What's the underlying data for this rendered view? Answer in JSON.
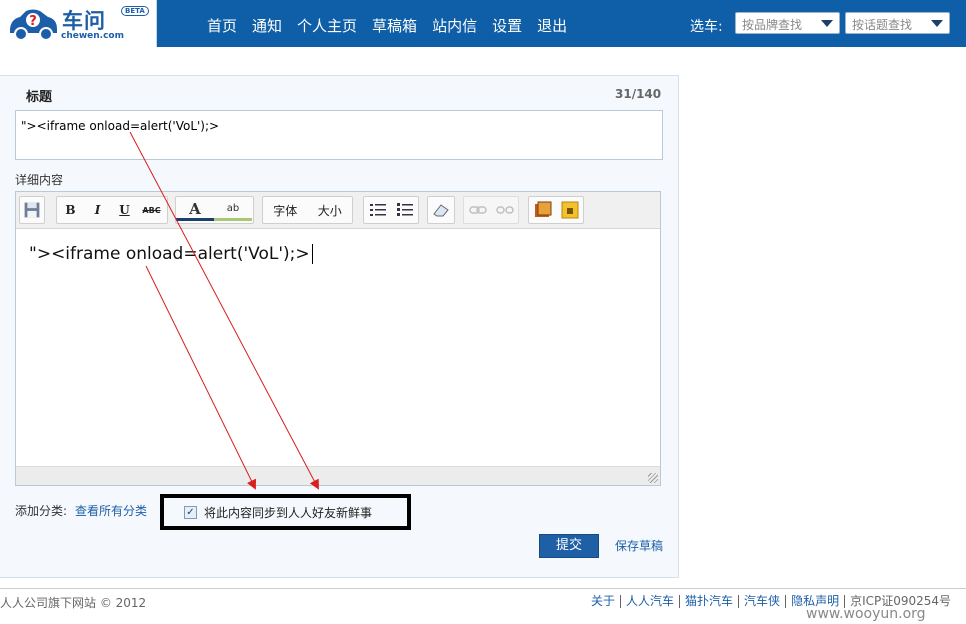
{
  "logo": {
    "brand": "车问",
    "badge": "BETA",
    "domain": "chewen.com"
  },
  "nav": [
    "首页",
    "通知",
    "个人主页",
    "草稿箱",
    "站内信",
    "设置",
    "退出"
  ],
  "car_picker": {
    "label": "选车:",
    "brand_placeholder": "按品牌查找",
    "topic_placeholder": "按话题查找"
  },
  "form": {
    "title_label": "标题",
    "counter": "31/140",
    "title_value": "\"><iframe onload=alert('VoL');>",
    "detail_label": "详细内容",
    "content_value": "\"><iframe onload=alert('VoL');>",
    "category_label": "添加分类:",
    "category_link": "查看所有分类",
    "sync_label": "将此内容同步到人人好友新鲜事",
    "sync_checked": true,
    "submit_label": "提交",
    "draft_label": "保存草稿"
  },
  "toolbar": {
    "bold": "B",
    "italic": "I",
    "underline": "U",
    "strike": "ABC",
    "font_color": "A",
    "highlight": "ab",
    "font_label": "字体",
    "size_label": "大小"
  },
  "footer": {
    "copyright": "人人公司旗下网站 © 2012",
    "links": [
      "关于",
      "人人汽车",
      "猫扑汽车",
      "汽车侠",
      "隐私声明"
    ],
    "icp": "京ICP证090254号"
  },
  "watermark": "www.wooyun.org",
  "colors": {
    "header": "#0f5ea8",
    "link": "#1d5ea8",
    "arrow": "#d81e1e"
  }
}
